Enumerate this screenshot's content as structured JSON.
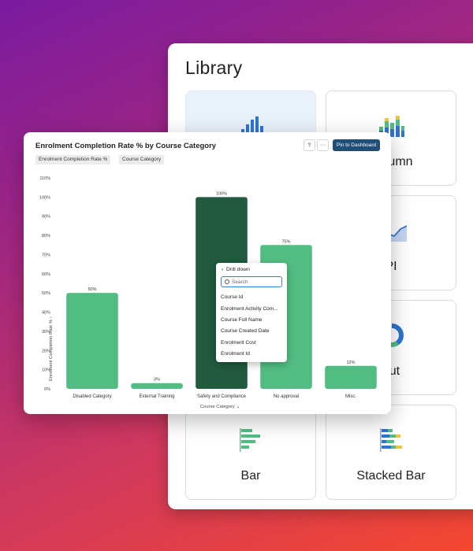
{
  "library": {
    "title": "Library",
    "tiles": [
      {
        "label": "",
        "icon": "column-chart-icon"
      },
      {
        "label": "Column",
        "icon": "stacked-column-icon"
      },
      {
        "label": "",
        "icon": "area-chart-icon"
      },
      {
        "label": "PI",
        "icon": "kpi-icon"
      },
      {
        "label": "",
        "icon": "blank"
      },
      {
        "label": "nut",
        "icon": "donut-chart-icon"
      },
      {
        "label": "Bar",
        "icon": "bar-chart-icon"
      },
      {
        "label": "Stacked Bar",
        "icon": "stacked-bar-icon"
      }
    ]
  },
  "card": {
    "title": "Enrolment Completion Rate % by Course Category",
    "share_icon": "share-icon",
    "more_icon": "more-icon",
    "pin_label": "Pin to Dashboard",
    "chips": [
      "Enrolment Completion Rate %",
      "Course Category"
    ]
  },
  "chart_data": {
    "type": "bar",
    "title": "Enrolment Completion Rate % by Course Category",
    "xlabel": "Course Category",
    "ylabel": "Enrolment Completion Rate %",
    "ylim": [
      0,
      110
    ],
    "yticks": [
      0,
      10,
      20,
      30,
      40,
      50,
      60,
      70,
      80,
      90,
      100,
      110
    ],
    "categories": [
      "Disabled Category",
      "External Training",
      "Safety and Compliance",
      "No approval",
      "Misc."
    ],
    "values": [
      50,
      3,
      100,
      75,
      12
    ],
    "data_labels": [
      "50%",
      "3%",
      "100%",
      "75%",
      "12%"
    ],
    "colors": [
      "#52bd83",
      "#52bd83",
      "#215a3e",
      "#52bd83",
      "#52bd83"
    ],
    "grid": false,
    "legend": "none"
  },
  "drilldown": {
    "title": "Drill down",
    "search_placeholder": "Search",
    "items": [
      "Course Id",
      "Enrolment Activity Com...",
      "Course Full Name",
      "Course Created Date",
      "Enrolment Cost",
      "Enrolment Id"
    ]
  }
}
